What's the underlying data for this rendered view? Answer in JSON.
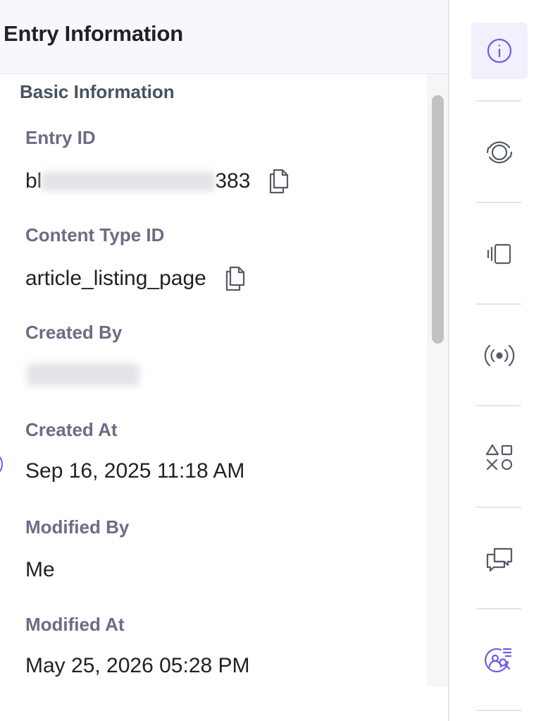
{
  "panel": {
    "title": "Entry Information",
    "section_title": "Basic Information",
    "fields": {
      "entry_id": {
        "label": "Entry ID",
        "value_prefix": "bl",
        "value_suffix": "383"
      },
      "content_type_id": {
        "label": "Content Type ID",
        "value": "article_listing_page"
      },
      "created_by": {
        "label": "Created By"
      },
      "created_at": {
        "label": "Created At",
        "value": "Sep 16, 2025 11:18 AM"
      },
      "modified_by": {
        "label": "Modified By",
        "value": "Me"
      },
      "modified_at": {
        "label": "Modified At",
        "value": "May 25, 2026 05:28 PM"
      }
    }
  },
  "rail": {
    "items": [
      {
        "icon": "info-icon",
        "active": true
      },
      {
        "icon": "target-icon",
        "active": false
      },
      {
        "icon": "device-preview-icon",
        "active": false
      },
      {
        "icon": "broadcast-icon",
        "active": false
      },
      {
        "icon": "shapes-icon",
        "active": false
      },
      {
        "icon": "comments-icon",
        "active": false
      },
      {
        "icon": "ai-assistant-icon",
        "active": false
      }
    ]
  },
  "colors": {
    "accent": "#6c5ce7",
    "label": "#6e6b86",
    "section": "#475161",
    "header_bg": "#f7f8fb",
    "icon": "#555b66"
  }
}
